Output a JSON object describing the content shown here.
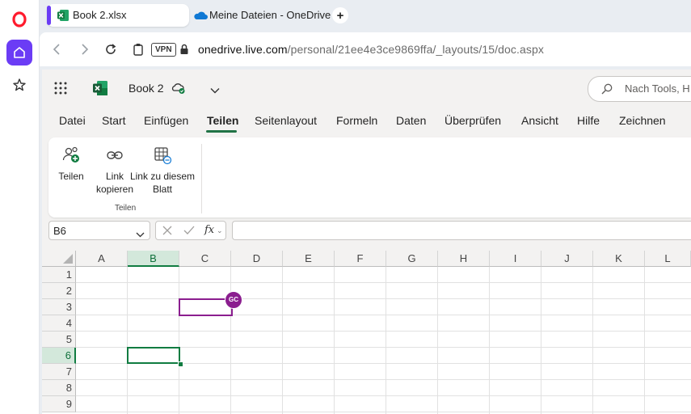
{
  "browser": {
    "tabs": [
      {
        "label": "Book 2.xlsx",
        "icon": "excel-icon",
        "active": true
      },
      {
        "label": "Meine Dateien - OneDrive",
        "icon": "onedrive-icon",
        "active": false
      }
    ],
    "vpn_label": "VPN",
    "url": {
      "host": "onedrive.live.com",
      "path": "/personal/21ee4e3ce9869ffa/_layouts/15/doc.aspx"
    }
  },
  "app": {
    "doc_name": "Book 2",
    "search_placeholder": "Nach Tools, H",
    "menu": [
      "Datei",
      "Start",
      "Einfügen",
      "Teilen",
      "Seitenlayout",
      "Formeln",
      "Daten",
      "Überprüfen",
      "Ansicht",
      "Hilfe",
      "Zeichnen"
    ],
    "active_menu": "Teilen",
    "ribbon": {
      "buttons": [
        {
          "line1": "Teilen",
          "line2": ""
        },
        {
          "line1": "Link",
          "line2": "kopieren"
        },
        {
          "line1": "Link zu diesem",
          "line2": "Blatt"
        }
      ],
      "group_label": "Teilen"
    },
    "formula_bar": {
      "name_box": "B6",
      "fx_label": "fx",
      "formula": ""
    },
    "grid": {
      "columns": [
        "A",
        "B",
        "C",
        "D",
        "E",
        "F",
        "G",
        "H",
        "I",
        "J",
        "K",
        "L"
      ],
      "rows": [
        "1",
        "2",
        "3",
        "4",
        "5",
        "6",
        "7",
        "8",
        "9"
      ],
      "selected_cell": "B6",
      "collaborator": {
        "initials": "GC",
        "cell": "C3",
        "color": "#8b1e8f"
      }
    }
  },
  "colors": {
    "accent": "#217346",
    "selection": "#107c41",
    "browser_accent": "#6b3cf5"
  }
}
